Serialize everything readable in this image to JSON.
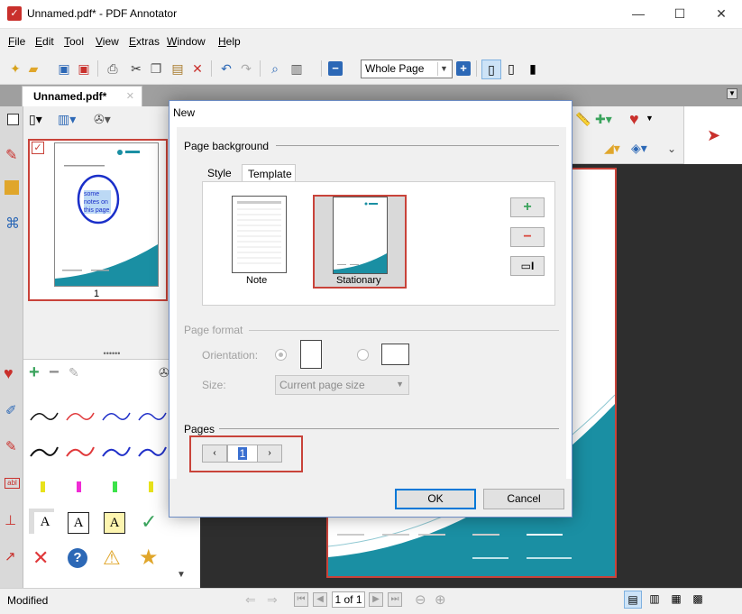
{
  "window": {
    "title": "Unnamed.pdf* - PDF Annotator",
    "min": "—",
    "max": "☐",
    "close": "✕"
  },
  "menu": [
    {
      "label": "File",
      "key": "F",
      "rest": "ile"
    },
    {
      "label": "Edit",
      "key": "E",
      "rest": "dit"
    },
    {
      "label": "Tool",
      "key": "T",
      "rest": "ool"
    },
    {
      "label": "View",
      "key": "V",
      "rest": "iew"
    },
    {
      "label": "Extras",
      "key": "E",
      "rest": "xtras"
    },
    {
      "label": "Window",
      "key": "W",
      "rest": "indow"
    },
    {
      "label": "Help",
      "key": "H",
      "rest": "elp"
    }
  ],
  "toolbar": {
    "zoom_value": "Whole Page",
    "zoom_minus": "−",
    "zoom_plus": "+"
  },
  "document_tab": {
    "label": "Unnamed.pdf*",
    "close": "✕"
  },
  "thumbnail": {
    "page_number": "1",
    "note_text": "some notes on this page"
  },
  "dialog": {
    "title": "New",
    "page_background_label": "Page background",
    "tabs": [
      "Style",
      "Template"
    ],
    "templates": [
      {
        "label": "Note"
      },
      {
        "label": "Stationary"
      }
    ],
    "add_symbol": "+",
    "remove_symbol": "−",
    "page_format_label": "Page format",
    "orientation_label": "Orientation:",
    "size_label": "Size:",
    "size_value": "Current page size",
    "pages_label": "Pages",
    "pages_value": "1",
    "prev_symbol": "‹",
    "next_symbol": "›",
    "ok_label": "OK",
    "cancel_label": "Cancel"
  },
  "status": {
    "text": "Modified",
    "page_indicator": "1 of 1"
  },
  "colors": {
    "accent_red": "#c9433a",
    "teal": "#1a8fa3",
    "blue": "#2c68b6"
  }
}
